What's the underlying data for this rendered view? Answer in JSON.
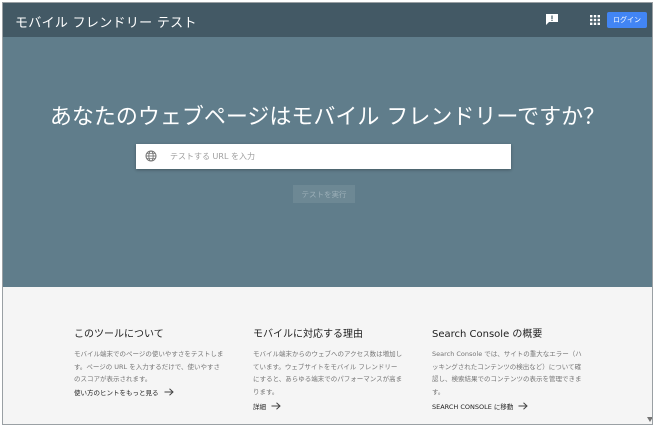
{
  "header": {
    "title": "モバイル フレンドリー テスト",
    "login_label": "ログイン",
    "icons": [
      "feedback-icon",
      "apps-grid-icon"
    ]
  },
  "hero": {
    "headline": "あなたのウェブページはモバイル フレンドリーですか？",
    "search_placeholder": "テストする URL を入力",
    "search_value": "",
    "run_button_label": "テストを実行",
    "icons": [
      "globe-icon"
    ]
  },
  "info": {
    "columns": [
      {
        "title": "このツールについて",
        "body": "モバイル端末でのページの使いやすさをテストします。ページの URL を入力するだけで、使いやすさのスコアが表示されます。",
        "link": "使い方のヒントをもっと見る"
      },
      {
        "title": "モバイルに対応する理由",
        "body": "モバイル端末からのウェブへのアクセス数は増加しています。ウェブサイトをモバイル フレンドリーにすると、あらゆる端末でのパフォーマンスが高まります。",
        "link": "詳細"
      },
      {
        "title": "Search Console の概要",
        "body": "Search Console では、サイトの重大なエラー（ハッキングされたコンテンツの検出など）について確認し、検索結果でのコンテンツの表示を管理できます。",
        "link": "SEARCH CONSOLE に移動"
      }
    ]
  },
  "colors": {
    "topbar": "#435965",
    "hero": "#607d8b",
    "accent": "#4285f4",
    "background": "#f5f5f5"
  }
}
